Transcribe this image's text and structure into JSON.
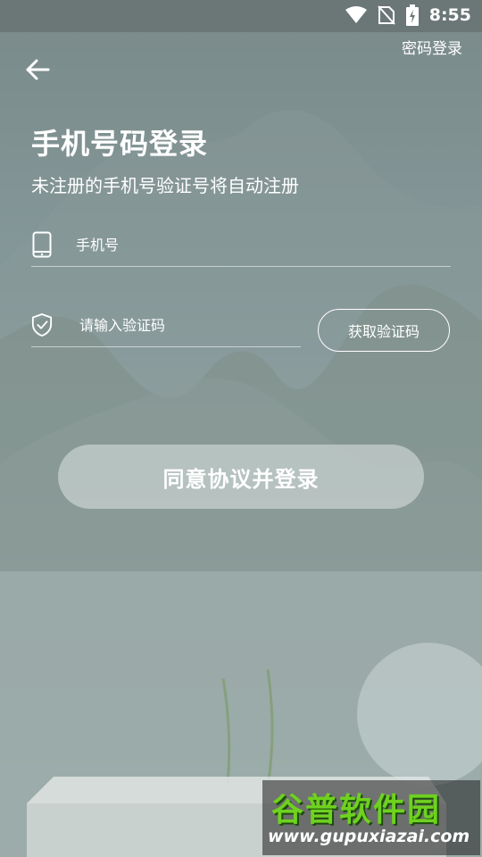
{
  "status_bar": {
    "time": "8:55"
  },
  "header": {
    "password_login_link": "密码登录"
  },
  "main": {
    "title": "手机号码登录",
    "subtitle": "未注册的手机号验证号将自动注册",
    "phone_field": {
      "placeholder": "手机号",
      "value": "",
      "icon": "phone-icon"
    },
    "code_field": {
      "placeholder": "请输入验证码",
      "value": "",
      "icon": "shield-check-icon"
    },
    "get_code_label": "获取验证码",
    "submit_label": "同意协议并登录"
  },
  "watermark": {
    "title": "谷普软件园",
    "url": "www.gupuxiazai.com"
  },
  "colors": {
    "accent": "#ffffff",
    "watermark_green": "#6fd21f"
  }
}
